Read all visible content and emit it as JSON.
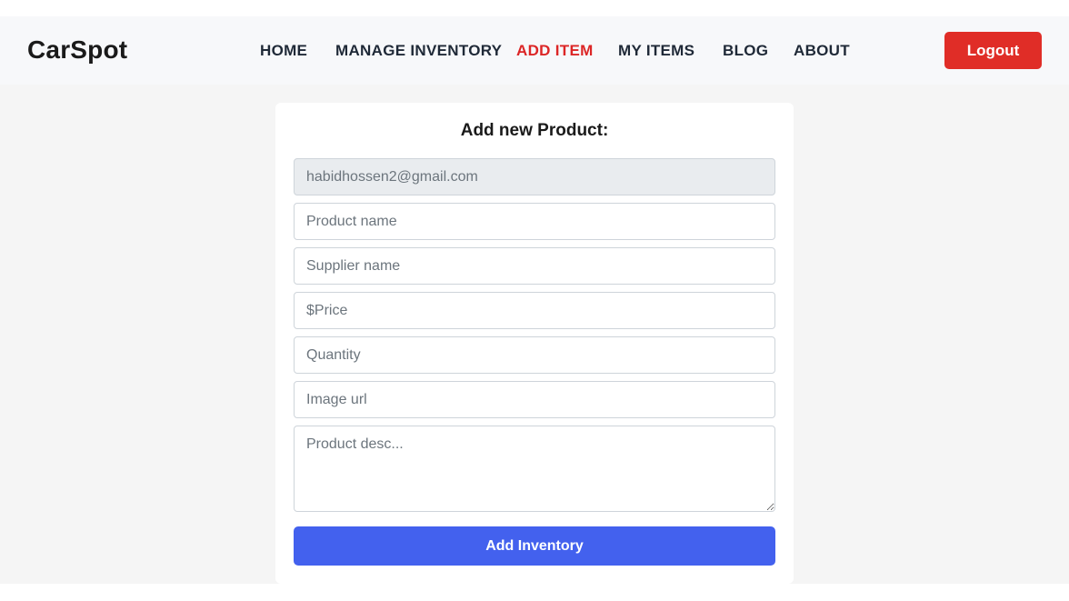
{
  "brand": "CarSpot",
  "nav": {
    "home": "HOME",
    "manage_inventory": "MANAGE INVENTORY",
    "add_item": "ADD ITEM",
    "my_items": "MY ITEMS",
    "blog": "BLOG",
    "about": "ABOUT",
    "active": "ADD ITEM"
  },
  "logout_label": "Logout",
  "form": {
    "title": "Add new Product:",
    "email_value": "habidhossen2@gmail.com",
    "product_name_placeholder": "Product name",
    "supplier_name_placeholder": "Supplier name",
    "price_placeholder": "$Price",
    "quantity_placeholder": "Quantity",
    "image_url_placeholder": "Image url",
    "description_placeholder": "Product desc...",
    "submit_label": "Add Inventory"
  },
  "colors": {
    "active_nav": "#dc2626",
    "logout_button": "#e02d27",
    "submit_button": "#4361ee"
  }
}
